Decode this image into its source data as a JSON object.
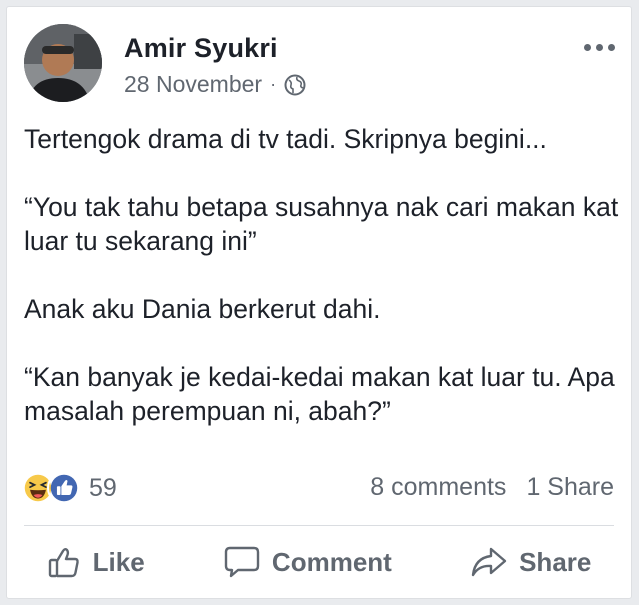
{
  "post": {
    "author": "Amir Syukri",
    "date": "28 November",
    "separator": "·",
    "privacy_icon": "globe-icon",
    "text": "Tertengok drama di tv tadi. Skripnya begini...\n\n“You tak tahu betapa susahnya nak cari makan kat luar tu sekarang ini”\n\nAnak aku Dania berkerut dahi.\n\n“Kan banyak je kedai-kedai makan kat luar tu. Apa masalah perempuan ni, abah?”"
  },
  "reactions": {
    "icons": [
      "haha-reaction-icon",
      "like-reaction-icon"
    ],
    "count": "59",
    "comments": "8 comments",
    "shares": "1 Share"
  },
  "actions": {
    "like": "Like",
    "comment": "Comment",
    "share": "Share"
  },
  "colors": {
    "like_blue": "#4267b2",
    "haha_yellow": "#f7c94a",
    "secondary_text": "#606770",
    "primary_text": "#1d2129"
  }
}
